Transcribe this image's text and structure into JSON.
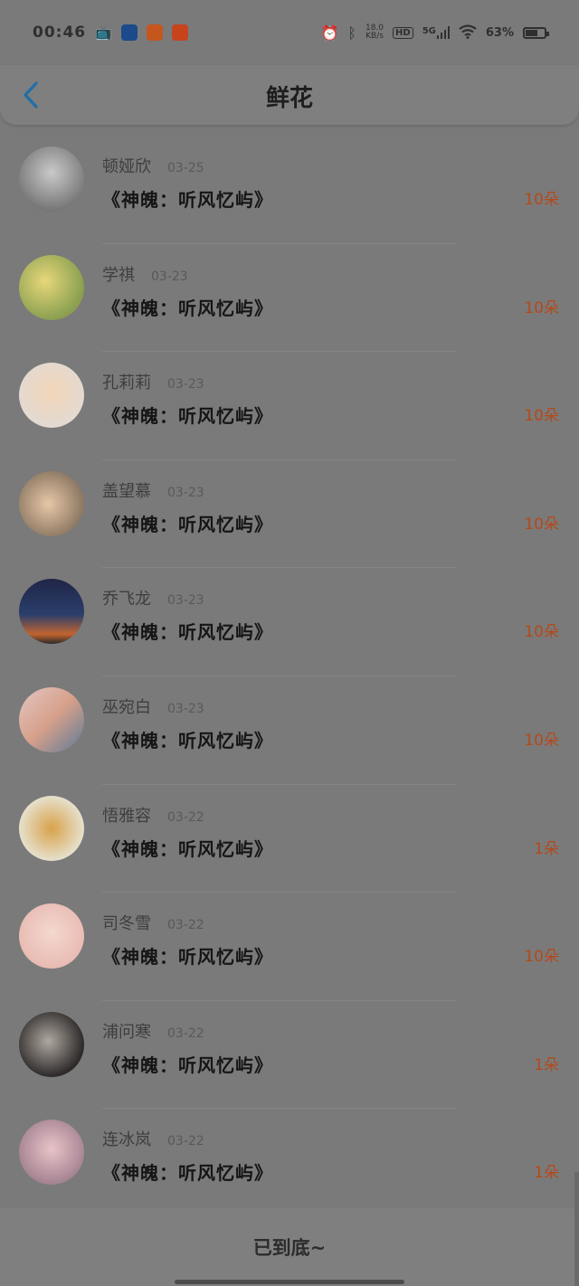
{
  "status_bar": {
    "time": "00:46",
    "speed_top": "18.0",
    "speed_bottom": "KB/s",
    "hd": "HD",
    "network": "5G",
    "battery": "63%",
    "battery_level": 0.63,
    "app_icons": [
      "tv-icon",
      "app-blue-icon",
      "app-orange-icon",
      "taobao-icon"
    ]
  },
  "header": {
    "title": "鲜花"
  },
  "rows": [
    {
      "name": "顿娅欣",
      "date": "03-25",
      "work": "《神魄：听风忆屿》",
      "amount": "10朵"
    },
    {
      "name": "学祺",
      "date": "03-23",
      "work": "《神魄：听风忆屿》",
      "amount": "10朵"
    },
    {
      "name": "孔莉莉",
      "date": "03-23",
      "work": "《神魄：听风忆屿》",
      "amount": "10朵"
    },
    {
      "name": "盖望慕",
      "date": "03-23",
      "work": "《神魄：听风忆屿》",
      "amount": "10朵"
    },
    {
      "name": "乔飞龙",
      "date": "03-23",
      "work": "《神魄：听风忆屿》",
      "amount": "10朵"
    },
    {
      "name": "巫宛白",
      "date": "03-23",
      "work": "《神魄：听风忆屿》",
      "amount": "10朵"
    },
    {
      "name": "悟雅容",
      "date": "03-22",
      "work": "《神魄：听风忆屿》",
      "amount": "1朵"
    },
    {
      "name": "司冬雪",
      "date": "03-22",
      "work": "《神魄：听风忆屿》",
      "amount": "10朵"
    },
    {
      "name": "浦问寒",
      "date": "03-22",
      "work": "《神魄：听风忆屿》",
      "amount": "1朵"
    },
    {
      "name": "连冰岚",
      "date": "03-22",
      "work": "《神魄：听风忆屿》",
      "amount": "1朵"
    }
  ],
  "footer": {
    "text": "已到底~"
  },
  "colors": {
    "accent": "#1f6fa8",
    "amount": "#b4491a",
    "overlay_bg": "#7a7a7a"
  }
}
